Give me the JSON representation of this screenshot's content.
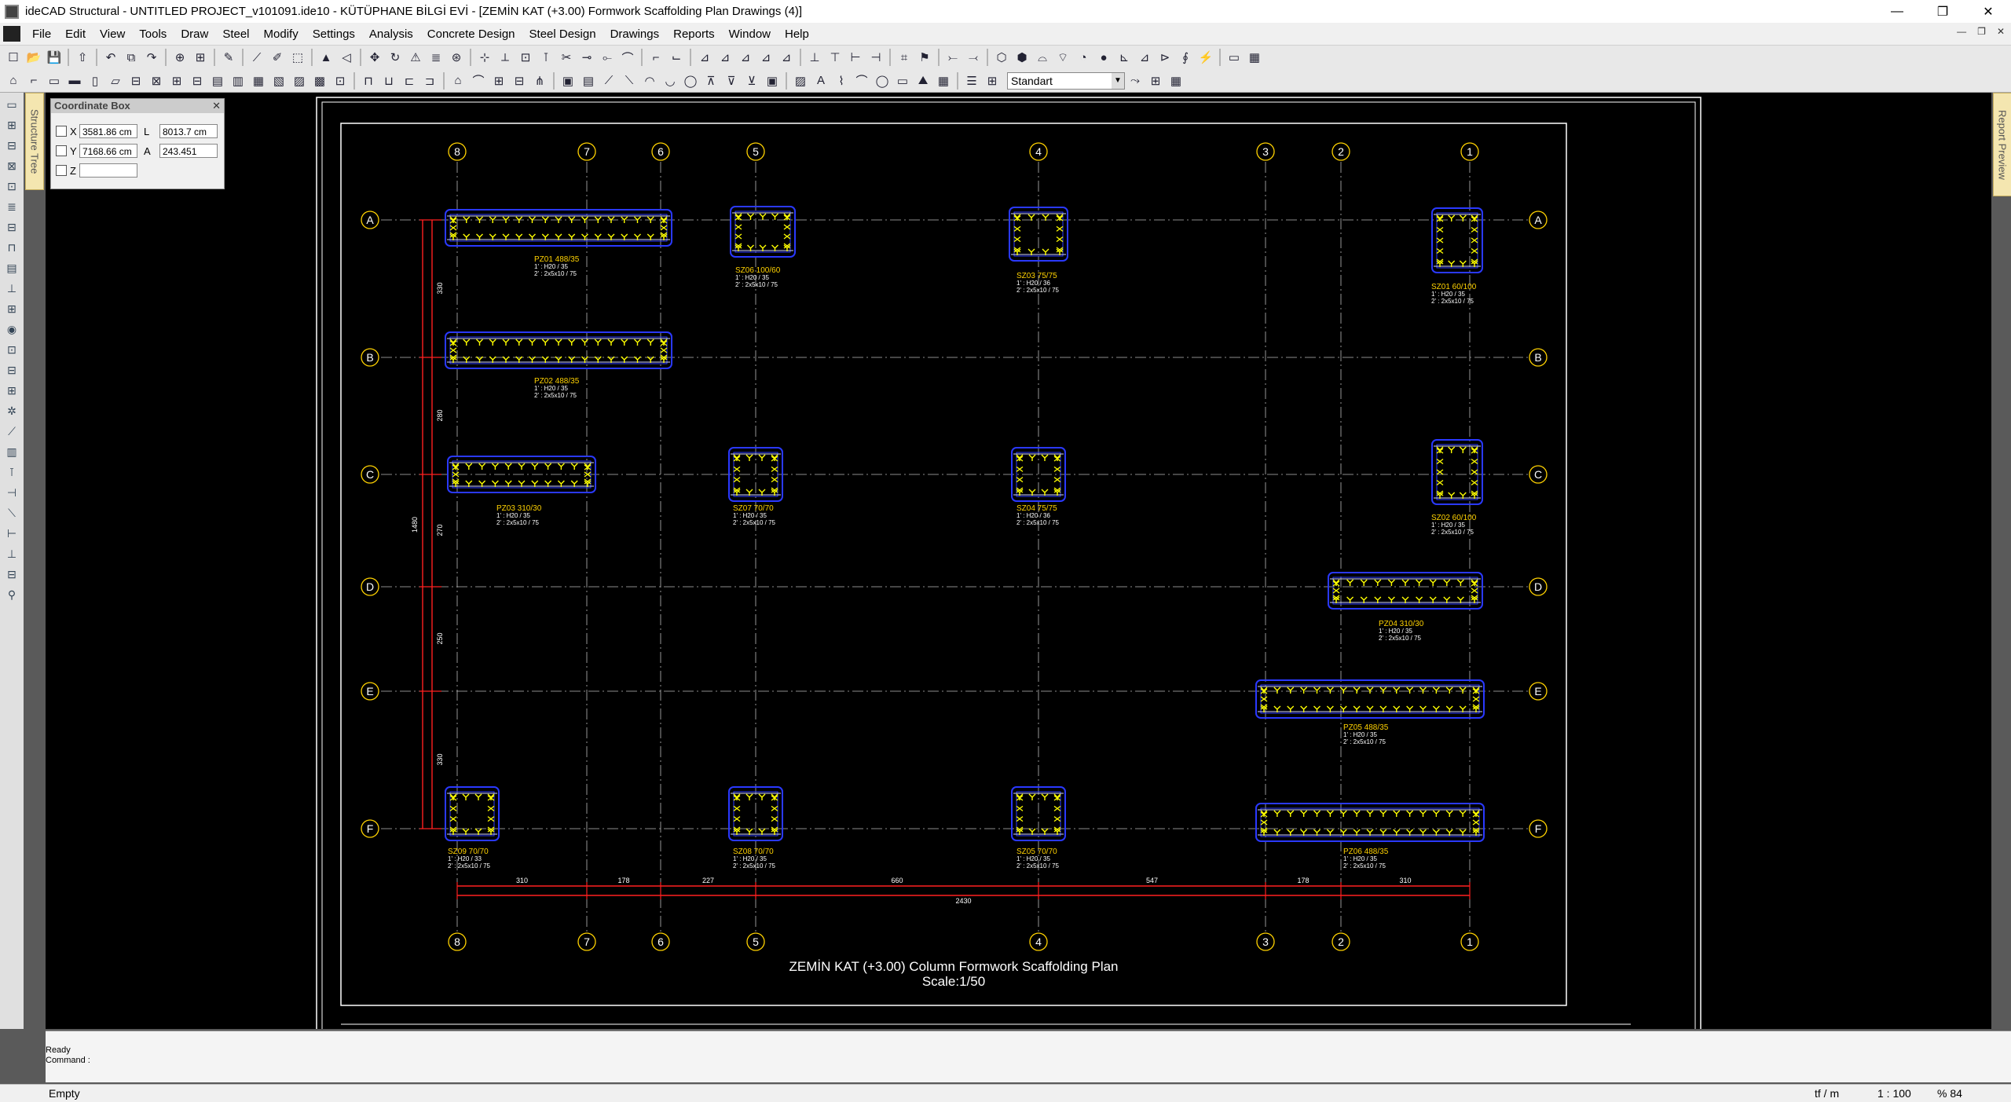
{
  "window": {
    "title": "ideCAD Structural - UNTITLED PROJECT_v101091.ide10 - KÜTÜPHANE BİLGİ EVİ - [ZEMİN KAT (+3.00) Formwork Scaffolding Plan Drawings (4)]",
    "minimize": "—",
    "restore": "❐",
    "close": "✕"
  },
  "menu": [
    "File",
    "Edit",
    "View",
    "Tools",
    "Draw",
    "Steel",
    "Modify",
    "Settings",
    "Analysis",
    "Concrete Design",
    "Steel Design",
    "Drawings",
    "Reports",
    "Window",
    "Help"
  ],
  "mdi_buttons": [
    "—",
    "❐",
    "✕"
  ],
  "toolbar": {
    "style_value": "Standart"
  },
  "side_tabs": {
    "left": "Structure Tree",
    "right": "Report Preview"
  },
  "coordinate_box": {
    "title": "Coordinate Box",
    "close": "✕",
    "x_label": "X",
    "x_value": "3581.86 cm",
    "y_label": "Y",
    "y_value": "7168.66 cm",
    "z_label": "Z",
    "z_value": "",
    "l_label": "L",
    "l_value": "8013.7 cm",
    "a_label": "A",
    "a_value": "243.451"
  },
  "drawing": {
    "title": "ZEMİN KAT (+3.00) Column Formwork Scaffolding Plan",
    "scale": "Scale:1/50",
    "axes_x": [
      "8",
      "7",
      "6",
      "5",
      "4",
      "3",
      "2",
      "1"
    ],
    "axes_y": [
      "A",
      "B",
      "C",
      "D",
      "E",
      "F"
    ],
    "dims_bottom": [
      "310",
      "178",
      "227",
      "660",
      "547",
      "178",
      "310"
    ],
    "dim_total": "2430",
    "dims_left": [
      "330",
      "280",
      "270",
      "250",
      "330"
    ],
    "dim_left_total": "1480",
    "columns": [
      {
        "name": "PZ01 488/35",
        "l1": "1' : H20 / 35",
        "l2": "2' : 2x5x10 / 75"
      },
      {
        "name": "SZ06 100/60",
        "l1": "1' : H20 / 35",
        "l2": "2' : 2x5x10 / 75"
      },
      {
        "name": "SZ03 75/75",
        "l1": "1' : H20 / 36",
        "l2": "2' : 2x5x10 / 75"
      },
      {
        "name": "SZ01 60/100",
        "l1": "1' : H20 / 35",
        "l2": "2' : 2x5x10 / 75"
      },
      {
        "name": "PZ02 488/35",
        "l1": "1' : H20 / 35",
        "l2": "2' : 2x5x10 / 75"
      },
      {
        "name": "PZ03 310/30",
        "l1": "1' : H20 / 35",
        "l2": "2' : 2x5x10 / 75"
      },
      {
        "name": "SZ07 70/70",
        "l1": "1' : H20 / 35",
        "l2": "2' : 2x5x10 / 75"
      },
      {
        "name": "SZ04 75/75",
        "l1": "1' : H20 / 36",
        "l2": "2' : 2x5x10 / 75"
      },
      {
        "name": "SZ02 60/100",
        "l1": "1' : H20 / 35",
        "l2": "2' : 2x5x10 / 75"
      },
      {
        "name": "PZ04 310/30",
        "l1": "1' : H20 / 35",
        "l2": "2' : 2x5x10 / 75"
      },
      {
        "name": "PZ05 488/35",
        "l1": "1' : H20 / 35",
        "l2": "2' : 2x5x10 / 75"
      },
      {
        "name": "SZ09 70/70",
        "l1": "1' : H20 / 33",
        "l2": "2' : 2x5x10 / 75"
      },
      {
        "name": "SZ08 70/70",
        "l1": "1' : H20 / 35",
        "l2": "2' : 2x5x10 / 75"
      },
      {
        "name": "SZ05 70/70",
        "l1": "1' : H20 / 35",
        "l2": "2' : 2x5x10 / 75"
      },
      {
        "name": "PZ06 488/35",
        "l1": "1' : H20 / 35",
        "l2": "2' : 2x5x10 / 75"
      }
    ]
  },
  "command": {
    "status": "Ready",
    "prompt": "Command :"
  },
  "statusbar": {
    "left": "Empty",
    "unit": "tf / m",
    "scale": "1 : 100",
    "zoom": "% 84"
  },
  "colors": {
    "axis_bubble": "#ffd200",
    "column_outline": "#2a39ff",
    "clamp": "#ffff00",
    "dimension": "#ff2020",
    "frame": "#ffffff"
  }
}
